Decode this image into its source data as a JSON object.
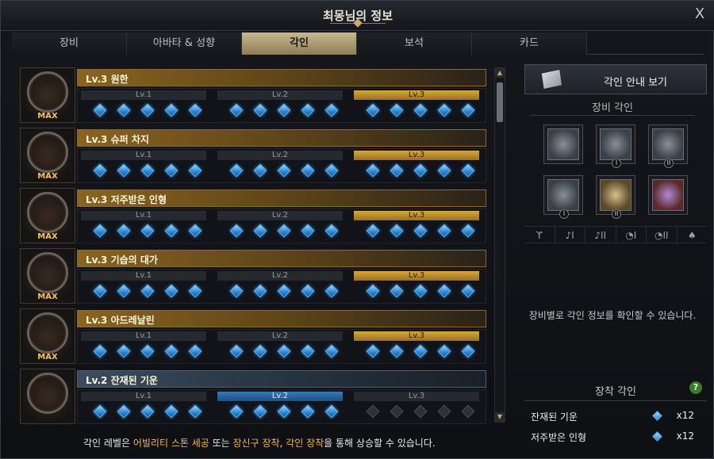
{
  "window": {
    "title": "최몽님의 정보",
    "close_label": "X"
  },
  "tabs": [
    {
      "label": "장비"
    },
    {
      "label": "아바타 & 성향"
    },
    {
      "label": "각인",
      "active": true
    },
    {
      "label": "보석"
    },
    {
      "label": "카드"
    }
  ],
  "icon_badge": "MAX",
  "engravings": [
    {
      "title": "Lv.3 원한",
      "level": 3,
      "max": true,
      "icon": "demon-face-icon"
    },
    {
      "title": "Lv.3 슈퍼 차지",
      "level": 3,
      "max": true,
      "icon": "charging-fighter-icon"
    },
    {
      "title": "Lv.3 저주받은 인형",
      "level": 3,
      "max": true,
      "icon": "cursed-doll-icon"
    },
    {
      "title": "Lv.3 기습의 대가",
      "level": 3,
      "max": true,
      "icon": "crescent-blade-icon"
    },
    {
      "title": "Lv.3 아드레날린",
      "level": 3,
      "max": true,
      "icon": "adrenaline-warrior-icon"
    },
    {
      "title": "Lv.2 잔재된 기운",
      "level": 2,
      "max": false,
      "icon": "lingering-aura-icon"
    }
  ],
  "level_labels": [
    "Lv.1",
    "Lv.2",
    "Lv.3"
  ],
  "right_panel": {
    "guide_button_label": "각인 안내 보기",
    "equipment_section_title": "장비 각인",
    "equipment_slots": [
      {
        "name": "necklace-slot",
        "style": "silver",
        "numeral": ""
      },
      {
        "name": "earring-1-slot",
        "style": "silver",
        "numeral": "I"
      },
      {
        "name": "earring-2-slot",
        "style": "silver",
        "numeral": "II"
      },
      {
        "name": "ring-1-slot",
        "style": "silver",
        "numeral": "I"
      },
      {
        "name": "ring-2-slot",
        "style": "gold",
        "numeral": "II"
      },
      {
        "name": "ability-stone-slot",
        "style": "purple",
        "numeral": ""
      }
    ],
    "part_icons": [
      "necklace-icon",
      "earring-I-icon",
      "earring-II-icon",
      "ring-I-icon",
      "ring-II-icon",
      "stone-icon"
    ],
    "part_icon_glyphs": [
      "ϒ",
      "♪I",
      "♪II",
      "◔I",
      "◔II",
      "♠"
    ],
    "info_text": "장비별로 각인 정보를 확인할 수 있습니다.",
    "worn_section_title": "장착 각인",
    "help_label": "?",
    "worn_engravings": [
      {
        "name": "잔재된 기운",
        "value": "x12"
      },
      {
        "name": "저주받은 인형",
        "value": "x12"
      }
    ]
  },
  "bottom_note": {
    "prefix": "각인 레벨은 ",
    "hl1": "어빌리티 스톤 세공",
    "mid1": " 또는 ",
    "hl2": "장신구 장착",
    "mid2": ", ",
    "hl3": "각인 장착",
    "suffix": "을 통해 상승할 수 있습니다."
  },
  "colors": {
    "gold_header": "#8a6420",
    "gem_blue": "#2a86d8",
    "highlight": "#f3b544",
    "active_tab": "#c9b890"
  }
}
